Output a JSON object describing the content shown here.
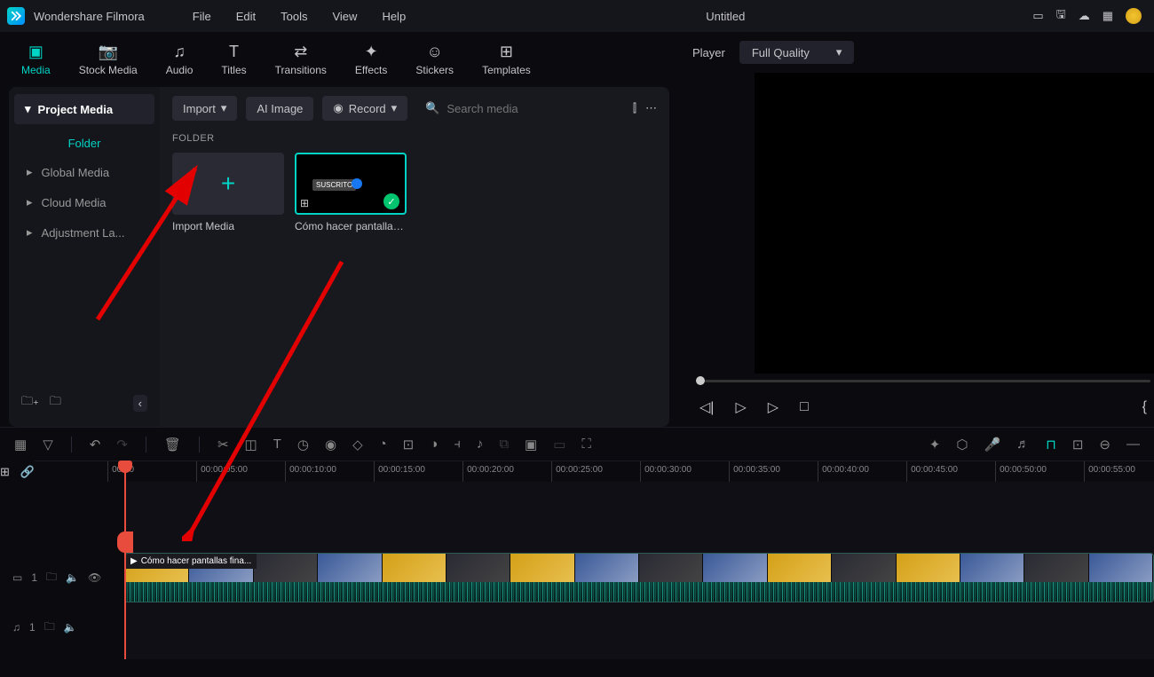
{
  "app": {
    "name": "Wondershare Filmora",
    "project": "Untitled"
  },
  "menu": [
    "File",
    "Edit",
    "Tools",
    "View",
    "Help"
  ],
  "tabs": [
    {
      "label": "Media",
      "active": true
    },
    {
      "label": "Stock Media"
    },
    {
      "label": "Audio"
    },
    {
      "label": "Titles"
    },
    {
      "label": "Transitions"
    },
    {
      "label": "Effects"
    },
    {
      "label": "Stickers"
    },
    {
      "label": "Templates"
    }
  ],
  "sidebar": {
    "header": "Project Media",
    "folder": "Folder",
    "items": [
      "Global Media",
      "Cloud Media",
      "Adjustment La..."
    ]
  },
  "toolbar": {
    "import": "Import",
    "ai_image": "AI Image",
    "record": "Record",
    "search_placeholder": "Search media"
  },
  "folder_label": "FOLDER",
  "media": {
    "import_card": "Import Media",
    "clip1": "Cómo hacer pantallas ...",
    "suscrito": "SUSCRITO"
  },
  "player": {
    "label": "Player",
    "quality": "Full Quality"
  },
  "ruler": [
    "00:00",
    "00:00:05:00",
    "00:00:10:00",
    "00:00:15:00",
    "00:00:20:00",
    "00:00:25:00",
    "00:00:30:00",
    "00:00:35:00",
    "00:00:40:00",
    "00:00:45:00",
    "00:00:50:00",
    "00:00:55:00"
  ],
  "tracks": {
    "video_label": "1",
    "audio_label": "1",
    "clip_name": "Cómo hacer pantallas fina..."
  }
}
